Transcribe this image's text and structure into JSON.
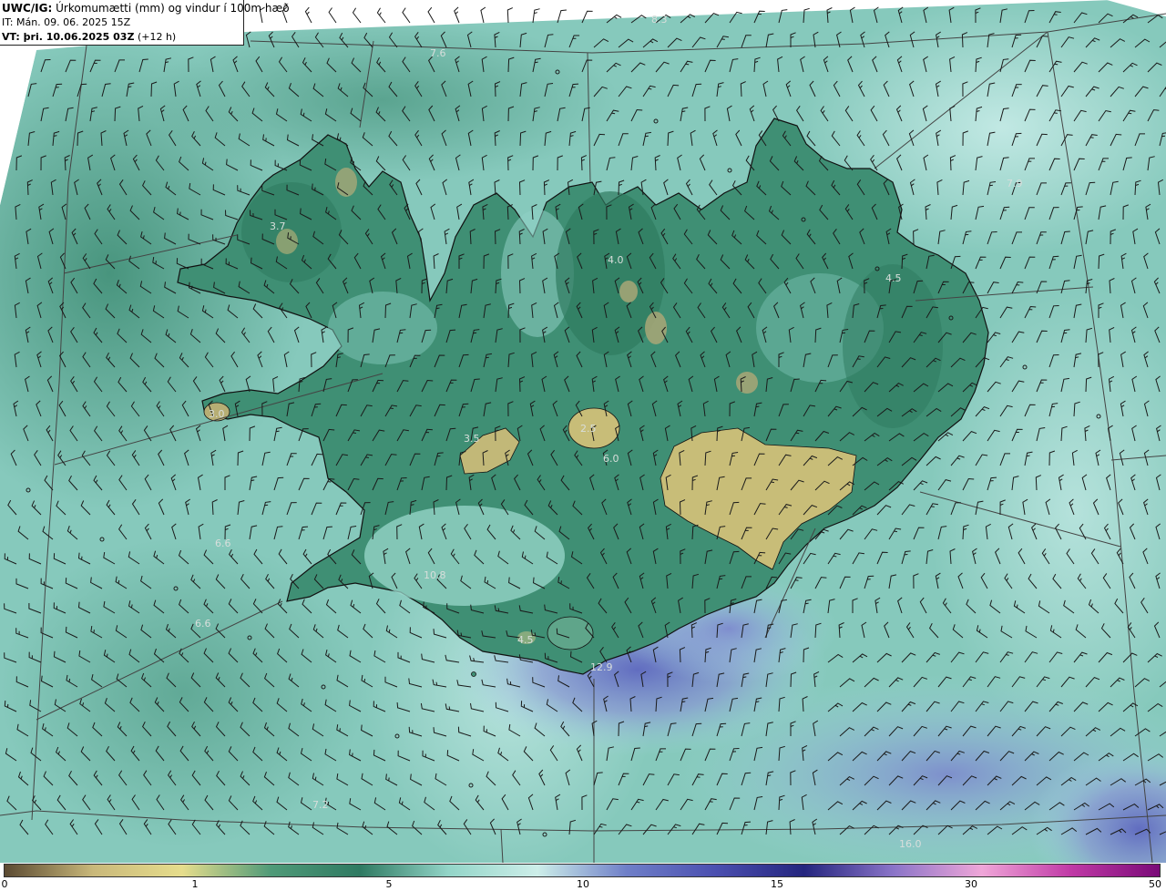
{
  "header": {
    "model": "UWC/IG:",
    "title": " Úrkomumætti (mm) og vindur í 100m hæð",
    "initial_time": "IT: Mán. 09. 06. 2025 15Z",
    "valid_label": "VT:",
    "valid_time": " þri. 10.06.2025 03Z",
    "forecast_offset": "(+12 h)"
  },
  "map_labels": [
    {
      "text": "8.3"
    },
    {
      "text": "7.6"
    },
    {
      "text": "7.9"
    },
    {
      "text": "3.7"
    },
    {
      "text": "4.0"
    },
    {
      "text": "4.5"
    },
    {
      "text": "3.0"
    },
    {
      "text": "3.5"
    },
    {
      "text": "2.5"
    },
    {
      "text": "6.0"
    },
    {
      "text": "6.6"
    },
    {
      "text": "10.8"
    },
    {
      "text": "6.6"
    },
    {
      "text": "4.5"
    },
    {
      "text": "12.9"
    },
    {
      "text": "7.2"
    },
    {
      "text": "16.0"
    }
  ],
  "colorbar": {
    "ticks": [
      {
        "label": "0",
        "value": 0
      },
      {
        "label": "1",
        "value": 1
      },
      {
        "label": "5",
        "value": 5
      },
      {
        "label": "10",
        "value": 10
      },
      {
        "label": "15",
        "value": 15
      },
      {
        "label": "30",
        "value": 30
      },
      {
        "label": "50",
        "value": 50
      }
    ],
    "stops": [
      "#5b4a32",
      "#c9b87a",
      "#e6dd8c",
      "#4f9a78",
      "#2f7a62",
      "#93d5c8",
      "#cdeee9",
      "#6f7fc8",
      "#4b4fb0",
      "#24257e",
      "#8a74c8",
      "#efa6d8",
      "#c03aa6",
      "#7a0a78"
    ]
  },
  "colors": {
    "sea": "#8fcfc3",
    "land": "#3f8d72",
    "highland": "#c7bd7a",
    "precip": "#7f8cd0",
    "coast": "#111111",
    "grid": "#444444",
    "barb": "#1a1a1a",
    "label": "#d8dedb"
  }
}
